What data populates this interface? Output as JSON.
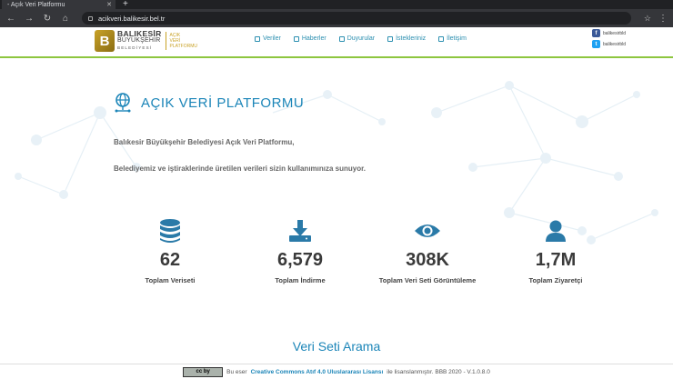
{
  "browser": {
    "tab_title": "- Açık Veri Platformu",
    "url": "acikveri.balikesir.bel.tr"
  },
  "header": {
    "logo": {
      "line1": "BALIKESİR",
      "line2": "BÜYÜKŞEHİR",
      "line3": "BELEDİYESİ",
      "sub1": "AÇIK",
      "sub2": "VERİ",
      "sub3": "PLATFORMU"
    },
    "nav": [
      {
        "label": "Veriler"
      },
      {
        "label": "Haberler"
      },
      {
        "label": "Duyurular"
      },
      {
        "label": "İstekleriniz"
      },
      {
        "label": "İletişim"
      }
    ],
    "social": [
      {
        "icon": "facebook-icon",
        "label": "balikesirbld"
      },
      {
        "icon": "twitter-icon",
        "label": "balikesirbld"
      }
    ]
  },
  "hero": {
    "title": "AÇIK VERİ PLATFORMU",
    "desc1": "Balıkesir Büyükşehir Belediyesi Açık Veri Platformu,",
    "desc2": "Belediyemiz ve iştiraklerinde üretilen verileri sizin kullanımınıza sunuyor."
  },
  "stats": [
    {
      "icon": "database-icon",
      "value": "62",
      "label": "Toplam Veriseti"
    },
    {
      "icon": "download-icon",
      "value": "6,579",
      "label": "Toplam İndirme"
    },
    {
      "icon": "eye-icon",
      "value": "308K",
      "label": "Toplam Veri Seti Görüntüleme"
    },
    {
      "icon": "user-icon",
      "value": "1,7M",
      "label": "Toplam Ziyaretçi"
    }
  ],
  "search": {
    "title": "Veri Seti Arama"
  },
  "footer": {
    "badge": "cc by",
    "text_before": "Bu eser",
    "link": "Creative Commons Atıf 4.0 Uluslararası Lisansı",
    "text_after": "ile lisanslanmıştır. BBB 2020 - V.1.0.8.0"
  },
  "colors": {
    "accent": "#1b85b8",
    "green_line": "#8dc63f",
    "gold": "#c9a227",
    "icon_blue": "#2a7aa8"
  }
}
